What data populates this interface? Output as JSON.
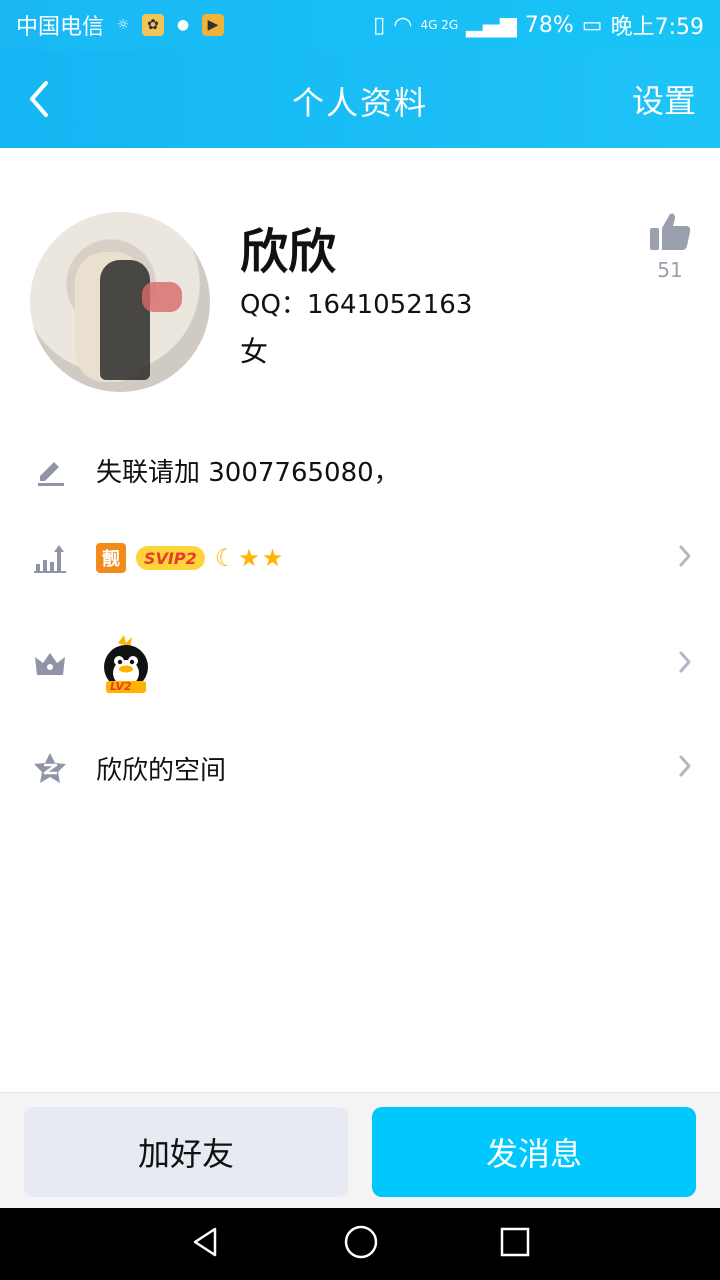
{
  "status_bar": {
    "carrier": "中国电信",
    "battery": "78%",
    "time": "晚上7:59",
    "network": "4G 2G"
  },
  "header": {
    "title": "个人资料",
    "settings_label": "设置"
  },
  "profile": {
    "name": "欣欣",
    "qq_label": "QQ：",
    "qq_number": "1641052163",
    "gender": "女",
    "likes": "51"
  },
  "rows": {
    "signature": "失联请加 3007765080，",
    "badges": {
      "liang": "靓",
      "svip": "SVIP2"
    },
    "penguin_level": "LV2",
    "space": "欣欣的空间"
  },
  "buttons": {
    "add_friend": "加好友",
    "send_message": "发消息"
  },
  "colors": {
    "header": "#18bdf5",
    "primary_button": "#00c8ff",
    "secondary_button": "#e7eaf3",
    "icon_gray": "#8f94a6"
  }
}
